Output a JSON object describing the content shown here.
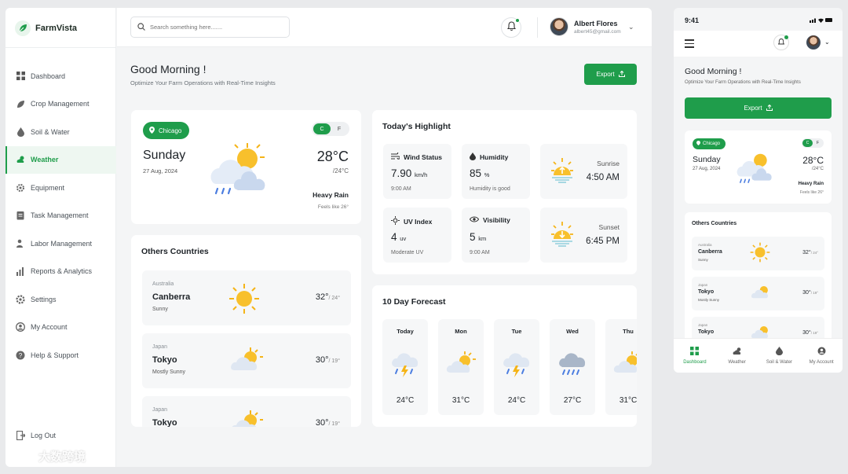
{
  "brand": {
    "name": "FarmVista",
    "accent": "#1f9d4b"
  },
  "sidebar": {
    "items": [
      {
        "label": "Dashboard",
        "icon": "grid-icon"
      },
      {
        "label": "Crop Management",
        "icon": "leaf-icon"
      },
      {
        "label": "Soil & Water",
        "icon": "water-drop-icon"
      },
      {
        "label": "Weather",
        "icon": "weather-icon"
      },
      {
        "label": "Equipment",
        "icon": "gear-icon"
      },
      {
        "label": "Task Management",
        "icon": "clipboard-icon"
      },
      {
        "label": "Labor Management",
        "icon": "worker-icon"
      },
      {
        "label": "Reports & Analytics",
        "icon": "chart-icon"
      },
      {
        "label": "Settings",
        "icon": "settings-icon"
      },
      {
        "label": "My Account",
        "icon": "account-icon"
      },
      {
        "label": "Help & Support",
        "icon": "help-icon"
      }
    ],
    "active_index": 3,
    "logout_label": "Log Out"
  },
  "search": {
    "placeholder": "Search something here......."
  },
  "user": {
    "name": "Albert Flores",
    "email": "albert45@gmail.com"
  },
  "page": {
    "title": "Good Morning !",
    "subtitle": "Optimize Your Farm Operations with Real-Time Insights",
    "export_label": "Export"
  },
  "current_weather": {
    "city": "Chicago",
    "unit_c": "C",
    "unit_f": "F",
    "day": "Sunday",
    "date": "27 Aug, 2024",
    "temp": "28°C",
    "temp_low": "/24°C",
    "condition": "Heavy Rain",
    "feels_like": "Feels like 26°"
  },
  "others_countries": {
    "title": "Others Countries",
    "rows": [
      {
        "country": "Australia",
        "city": "Canberra",
        "condition": "Sunny",
        "hi": "32°",
        "lo": "/ 24°",
        "icon": "sun-icon"
      },
      {
        "country": "Japan",
        "city": "Tokyo",
        "condition": "Mostly Sunny",
        "hi": "30°",
        "lo": "/ 19°",
        "icon": "partly-sunny-icon"
      },
      {
        "country": "Japan",
        "city": "Tokyo",
        "condition": "",
        "hi": "30°",
        "lo": "/ 19°",
        "icon": "partly-sunny-icon"
      }
    ]
  },
  "highlight": {
    "title": "Today's Highlight",
    "wind": {
      "label": "Wind Status",
      "value": "7.90",
      "unit": "km/h",
      "note": "9:00 AM"
    },
    "humidity": {
      "label": "Humidity",
      "value": "85",
      "unit": "%",
      "note": "Humidity is good"
    },
    "uv": {
      "label": "UV Index",
      "value": "4",
      "unit": "uv",
      "note": "Moderate UV"
    },
    "visibility": {
      "label": "Visibility",
      "value": "5",
      "unit": "km",
      "note": "9:00 AM"
    },
    "sunrise": {
      "label": "Sunrise",
      "value": "4:50 AM"
    },
    "sunset": {
      "label": "Sunset",
      "value": "6:45 PM"
    }
  },
  "forecast": {
    "title": "10 Day Forecast",
    "days": [
      {
        "day": "Today",
        "temp": "24°C",
        "icon": "thunderstorm-icon"
      },
      {
        "day": "Mon",
        "temp": "31°C",
        "icon": "partly-sunny-icon"
      },
      {
        "day": "Tue",
        "temp": "24°C",
        "icon": "thunderstorm-icon"
      },
      {
        "day": "Wed",
        "temp": "27°C",
        "icon": "rain-icon"
      },
      {
        "day": "Thu",
        "temp": "31°C",
        "icon": "partly-sunny-icon"
      }
    ]
  },
  "mobile": {
    "time": "9:41",
    "rows": [
      {
        "country": "Australia",
        "city": "Canberra",
        "condition": "Sunny",
        "hi": "32°",
        "lo": "/ 24°"
      },
      {
        "country": "Japan",
        "city": "Tokyo",
        "condition": "Mostly Sunny",
        "hi": "30°",
        "lo": "/ 19°"
      },
      {
        "country": "Japan",
        "city": "Tokyo",
        "condition": "",
        "hi": "30°",
        "lo": "/ 19°"
      }
    ],
    "tabs": [
      {
        "label": "Dashboard",
        "icon": "grid-icon"
      },
      {
        "label": "Weather",
        "icon": "weather-icon"
      },
      {
        "label": "Soil & Water",
        "icon": "water-drop-icon"
      },
      {
        "label": "My Account",
        "icon": "account-icon"
      }
    ]
  },
  "watermark": "大数跨境"
}
